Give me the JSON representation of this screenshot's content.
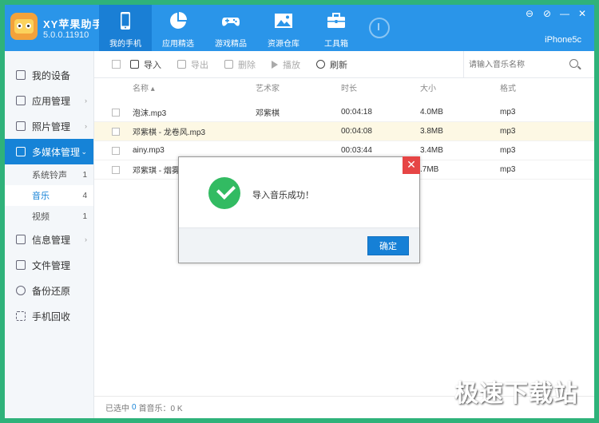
{
  "app": {
    "name": "XY苹果助手",
    "version": "5.0.0.11910",
    "device": "iPhone5c"
  },
  "window_controls": [
    "⊖",
    "⊘",
    "—",
    "✕"
  ],
  "nav": [
    {
      "label": "我的手机",
      "icon": "phone-icon",
      "active": true
    },
    {
      "label": "应用精选",
      "icon": "apps-pie-icon",
      "active": false
    },
    {
      "label": "游戏精品",
      "icon": "gamepad-icon",
      "active": false
    },
    {
      "label": "资源仓库",
      "icon": "image-icon",
      "active": false
    },
    {
      "label": "工具箱",
      "icon": "toolbox-icon",
      "active": false
    }
  ],
  "sidebar": {
    "items": [
      {
        "label": "我的设备",
        "icon": "device-icon",
        "chevron": "",
        "active": false
      },
      {
        "label": "应用管理",
        "icon": "grid-icon",
        "chevron": "›",
        "active": false
      },
      {
        "label": "照片管理",
        "icon": "photo-icon",
        "chevron": "›",
        "active": false
      },
      {
        "label": "多媒体管理",
        "icon": "monitor-icon",
        "chevron": "⌄",
        "active": true
      }
    ],
    "sub_items": [
      {
        "label": "系统铃声",
        "count": "1",
        "active": false
      },
      {
        "label": "音乐",
        "count": "4",
        "active": true
      },
      {
        "label": "视频",
        "count": "1",
        "active": false
      }
    ],
    "items_after": [
      {
        "label": "信息管理",
        "icon": "message-icon",
        "chevron": "›"
      },
      {
        "label": "文件管理",
        "icon": "folder-icon",
        "chevron": ""
      },
      {
        "label": "备份还原",
        "icon": "backup-icon",
        "chevron": ""
      },
      {
        "label": "手机回收",
        "icon": "recycle-icon",
        "chevron": ""
      }
    ]
  },
  "toolbar": {
    "import_label": "导入",
    "export_label": "导出",
    "delete_label": "删除",
    "play_label": "播放",
    "refresh_label": "刷新",
    "search_placeholder": "请输入音乐名称"
  },
  "table": {
    "columns": [
      "名称 ▴",
      "艺术家",
      "时长",
      "大小",
      "格式"
    ],
    "rows": [
      {
        "name": "泡沫.mp3",
        "artist": "邓紫棋",
        "duration": "00:04:18",
        "size": "4.0MB",
        "format": "mp3",
        "highlight": false
      },
      {
        "name": "邓紫棋 - 龙卷风.mp3",
        "artist": "",
        "duration": "00:04:08",
        "size": "3.8MB",
        "format": "mp3",
        "highlight": true
      },
      {
        "name": "ainy.mp3",
        "artist": "",
        "duration": "00:03:44",
        "size": "3.4MB",
        "format": "mp3",
        "highlight": false
      },
      {
        "name": "邓紫琪 - 烟雾仪",
        "artist": "",
        "duration": "",
        "size": ".7MB",
        "format": "mp3",
        "highlight": false
      }
    ]
  },
  "status": {
    "prefix": "已选中",
    "selected": "0",
    "suffix": "首音乐：0 K"
  },
  "dialog": {
    "message": "导入音乐成功！",
    "ok_label": "确定",
    "close_label": "✕"
  },
  "watermark": "极速下载站"
}
